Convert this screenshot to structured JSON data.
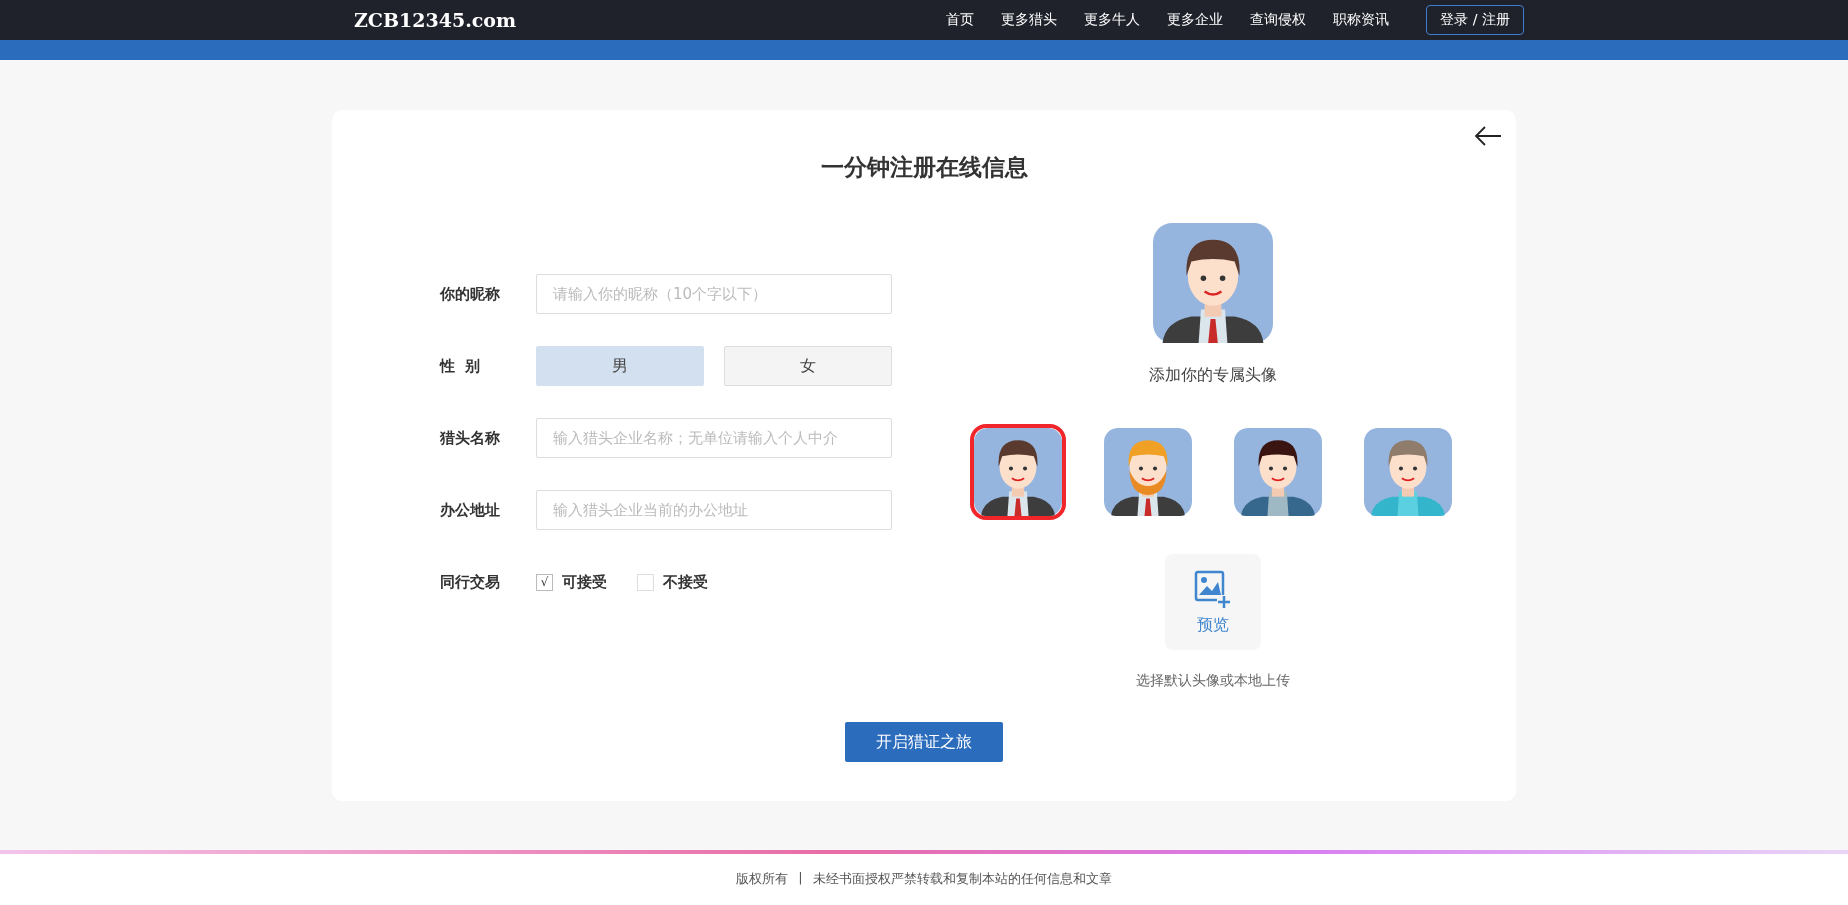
{
  "header": {
    "logo": "ZCB12345.com",
    "nav": [
      {
        "label": "首页"
      },
      {
        "label": "更多猎头"
      },
      {
        "label": "更多牛人"
      },
      {
        "label": "更多企业"
      },
      {
        "label": "查询侵权"
      },
      {
        "label": "职称资讯"
      }
    ],
    "login": "登录 / 注册"
  },
  "form": {
    "title": "一分钟注册在线信息",
    "nickname": {
      "label": "你的昵称",
      "placeholder": "请输入你的昵称（10个字以下）"
    },
    "gender": {
      "label": "性  别",
      "options": [
        {
          "label": "男",
          "selected": true
        },
        {
          "label": "女",
          "selected": false
        }
      ]
    },
    "company": {
      "label": "猎头名称",
      "placeholder": "输入猎头企业名称；无单位请输入个人中介"
    },
    "address": {
      "label": "办公地址",
      "placeholder": "输入猎头企业当前的办公地址"
    },
    "trade": {
      "label": "同行交易",
      "options": [
        {
          "label": "可接受",
          "checked": true,
          "mark": "√"
        },
        {
          "label": "不接受",
          "checked": false
        }
      ]
    },
    "submit": "开启猎证之旅"
  },
  "avatar": {
    "caption": "添加你的专属头像",
    "choices": [
      {
        "kind": "suit",
        "selected": true
      },
      {
        "kind": "beard",
        "selected": false
      },
      {
        "kind": "hoodie",
        "selected": false
      },
      {
        "kind": "sweater",
        "selected": false
      }
    ],
    "preview": "预览",
    "hint": "选择默认头像或本地上传"
  },
  "footer": {
    "copyright": "版权所有",
    "separator": "|",
    "notice": "未经书面授权严禁转载和复制本站的任何信息和文章"
  }
}
